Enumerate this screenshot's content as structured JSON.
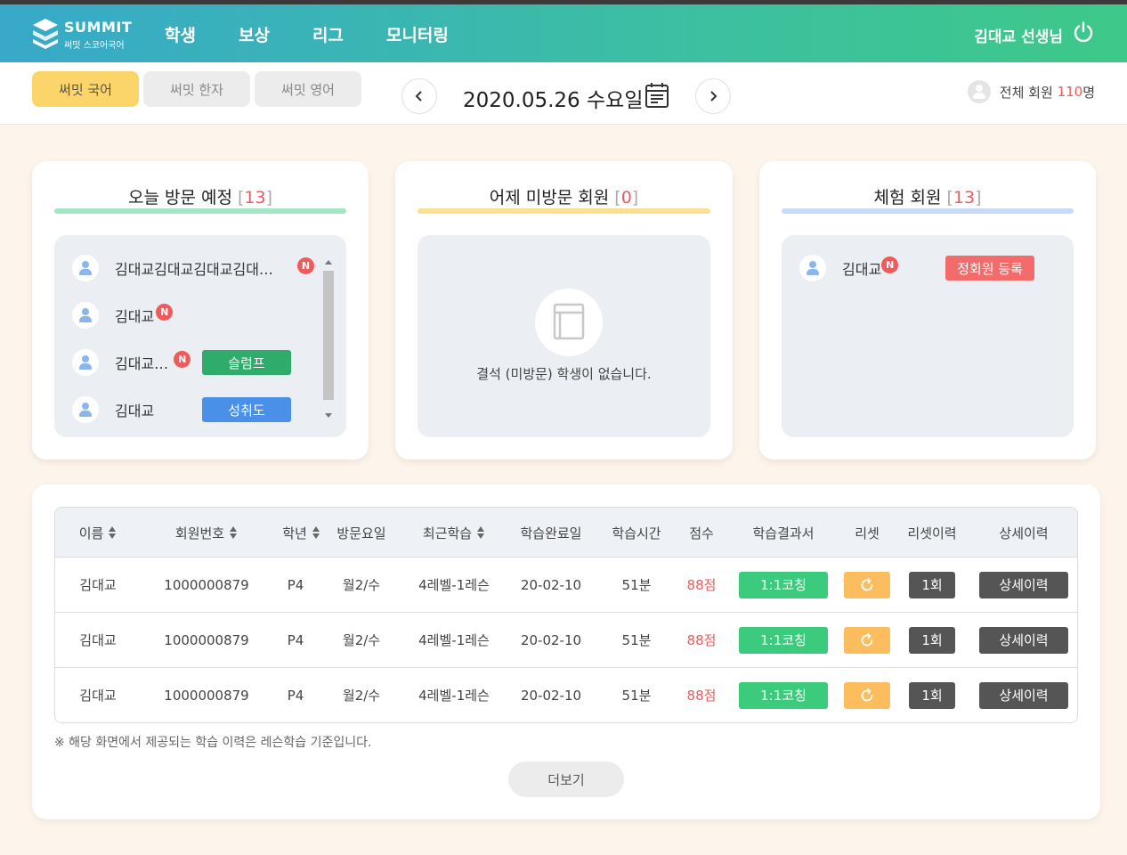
{
  "header": {
    "logo_title": "SUMMIT",
    "logo_subtitle": "써밋 스코어국어",
    "nav": [
      "학생",
      "보상",
      "리그",
      "모니터링"
    ],
    "teacher": "김대교 선생님",
    "power_icon": "power-icon"
  },
  "subbar": {
    "tabs": [
      "써밋 국어",
      "써밋 한자",
      "써밋 영어"
    ],
    "active_tab": "써밋 국어",
    "date": "2020.05.26 수요일",
    "prev_icon": "chevron-left-icon",
    "next_icon": "chevron-right-icon",
    "calendar_icon": "calendar-icon",
    "total_label": "전체 회원",
    "total_count": "110",
    "total_unit": "명"
  },
  "cards": {
    "today": {
      "title": "오늘 방문 예정",
      "open": "[",
      "count": "13",
      "close": "]",
      "line_color": "#a3e5c4",
      "items": [
        {
          "name": "김대교김대교김대교김대…",
          "badge": "N",
          "tag": ""
        },
        {
          "name": "김대교",
          "badge": "N",
          "tag": ""
        },
        {
          "name": "김대교…",
          "badge": "N",
          "tag": "슬럼프"
        },
        {
          "name": "김대교",
          "badge": "",
          "tag": "성취도"
        }
      ]
    },
    "absent": {
      "title": "어제 미방문 회원",
      "open": "[",
      "count": "0",
      "close": "]",
      "line_color": "#fde08f",
      "empty_text": "결석 (미방문) 학생이 없습니다.",
      "empty_icon": "notebook-icon"
    },
    "trial": {
      "title": "체험 회원",
      "open": "[",
      "count": "13",
      "close": "]",
      "line_color": "#c5dbf7",
      "items": [
        {
          "name": "김대교",
          "badge": "N",
          "action": "정회원 등록"
        }
      ]
    }
  },
  "table": {
    "headers": [
      "이름",
      "회원번호",
      "학년",
      "방문요일",
      "최근학습",
      "학습완료일",
      "학습시간",
      "점수",
      "학습결과서",
      "리셋",
      "리셋이력",
      "상세이력"
    ],
    "rows": [
      {
        "name": "김대교",
        "id": "1000000879",
        "grade": "P4",
        "days": "월2/수",
        "recent": "4레벨-1레슨",
        "done": "20-02-10",
        "time": "51분",
        "score": "88점",
        "report": "1:1코칭",
        "reset_icon": "refresh-icon",
        "reset_count": "1회",
        "detail": "상세이력"
      },
      {
        "name": "김대교",
        "id": "1000000879",
        "grade": "P4",
        "days": "월2/수",
        "recent": "4레벨-1레슨",
        "done": "20-02-10",
        "time": "51분",
        "score": "88점",
        "report": "1:1코칭",
        "reset_icon": "refresh-icon",
        "reset_count": "1회",
        "detail": "상세이력"
      },
      {
        "name": "김대교",
        "id": "1000000879",
        "grade": "P4",
        "days": "월2/수",
        "recent": "4레벨-1레슨",
        "done": "20-02-10",
        "time": "51분",
        "score": "88점",
        "report": "1:1코칭",
        "reset_icon": "refresh-icon",
        "reset_count": "1회",
        "detail": "상세이력"
      }
    ],
    "note": "※ 해당 화면에서 제공되는 학습 이력은 레슨학습 기준입니다.",
    "more": "더보기"
  },
  "colors": {
    "accent_green": "#3cca7c",
    "accent_red": "#f05a5a",
    "accent_yellow": "#fcd56a",
    "orange": "#fcbd5e",
    "tag_green": "#2fab6c",
    "tag_blue": "#4a8fe8",
    "tag_red": "#f46b6b"
  }
}
